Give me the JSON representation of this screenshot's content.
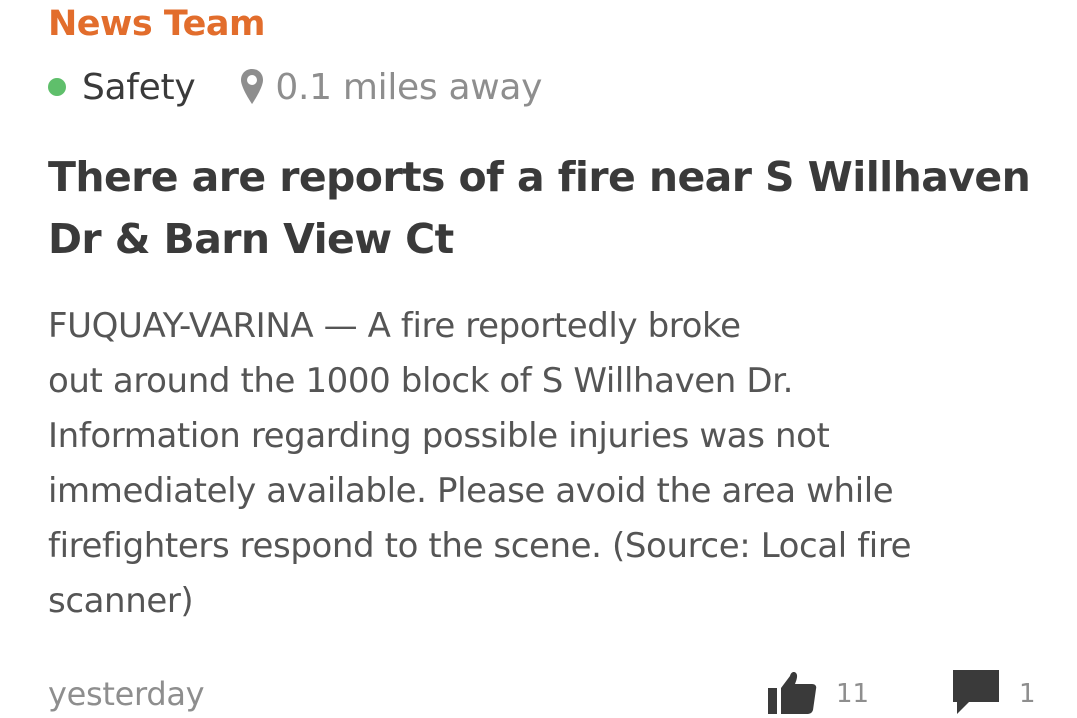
{
  "post": {
    "author": "News Team",
    "category": "Safety",
    "category_color": "#5fbf6b",
    "location_icon": "map-pin-icon",
    "distance": "0.1 miles away",
    "headline": "There are reports of a fire near S Willhaven Dr & Barn View Ct",
    "body_lines": [
      "FUQUAY-VARINA — A fire reportedly broke",
      "out around the 1000 block of S Willhaven Dr.",
      "Information regarding possible injuries was not",
      "immediately available. Please avoid the area while",
      "firefighters respond to the scene. (Source: Local fire",
      "scanner)"
    ],
    "timestamp": "yesterday",
    "thanks_icon": "thumbs-up-icon",
    "thanks_count": "11",
    "reply_icon": "speech-bubble-icon",
    "reply_count": "1",
    "icon_color": "#3a3a3a"
  }
}
